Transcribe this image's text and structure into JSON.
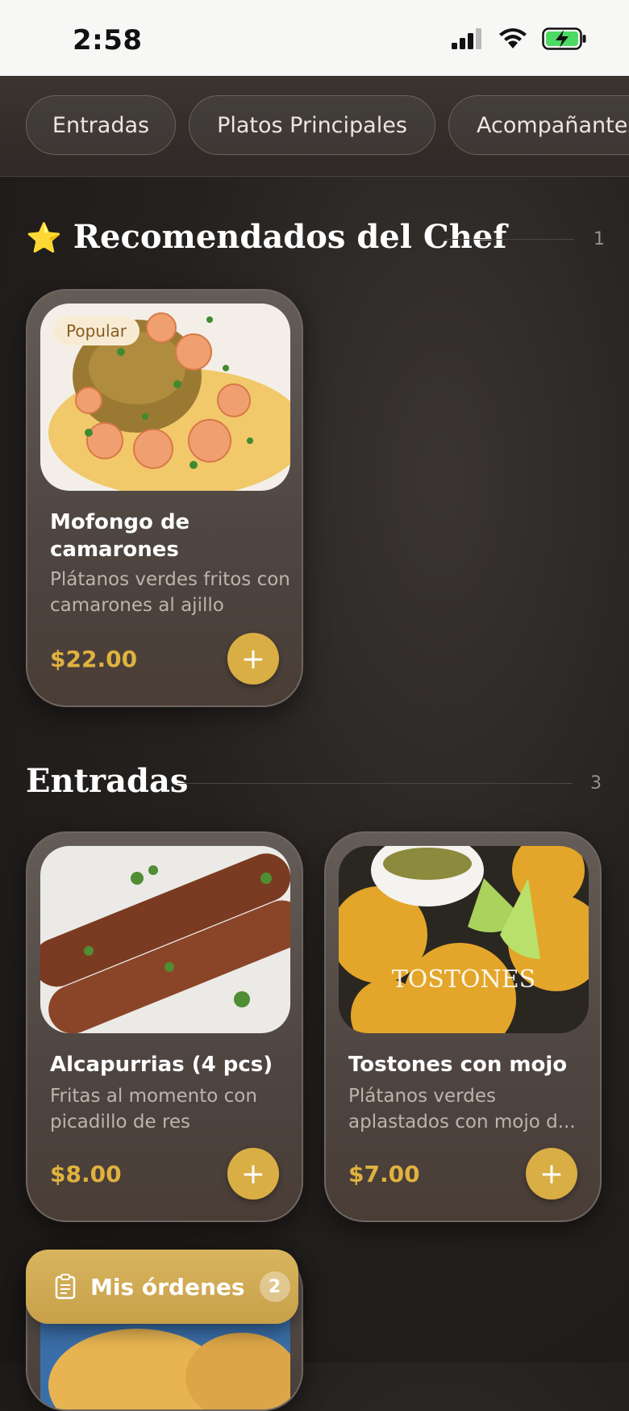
{
  "status_bar": {
    "time": "2:58"
  },
  "categories": [
    "Entradas",
    "Platos Principales",
    "Acompañantes"
  ],
  "sections": [
    {
      "title": "Recomendados del Chef",
      "emoji": "⭐",
      "count": "1",
      "items": [
        {
          "name": "Mofongo de camarones",
          "description": "Plátanos verdes fritos con camarones al ajillo",
          "price": "$22.00",
          "badge": "Popular"
        }
      ]
    },
    {
      "title": "Entradas",
      "count": "3",
      "items": [
        {
          "name": "Alcapurrias (4 pcs)",
          "description": "Fritas al momento con picadillo de res",
          "price": "$8.00"
        },
        {
          "name": "Tostones con mojo",
          "description": "Plátanos verdes aplastados con mojo d...",
          "price": "$7.00",
          "image_text": "TOSTONES"
        }
      ]
    }
  ],
  "orders": {
    "label": "Mis órdenes",
    "count": "2"
  },
  "colors": {
    "accent": "#d9ae45",
    "price": "#e0b23e"
  }
}
